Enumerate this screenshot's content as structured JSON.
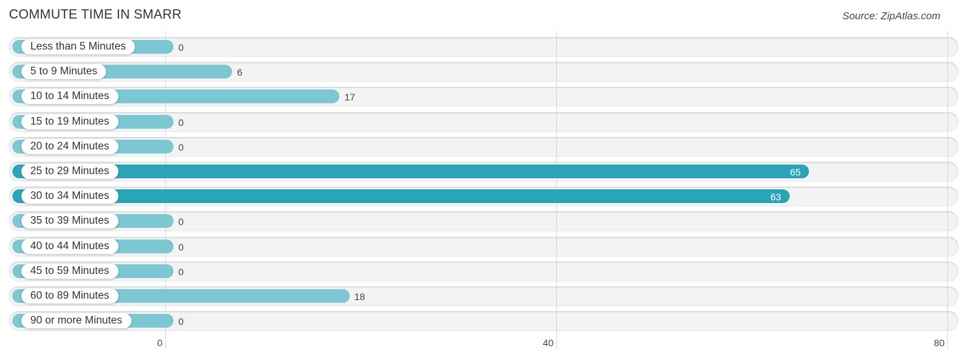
{
  "title": "COMMUTE TIME IN SMARR",
  "source": "Source: ZipAtlas.com",
  "chart_data": {
    "type": "bar",
    "orientation": "horizontal",
    "title": "COMMUTE TIME IN SMARR",
    "categories": [
      "Less than 5 Minutes",
      "5 to 9 Minutes",
      "10 to 14 Minutes",
      "15 to 19 Minutes",
      "20 to 24 Minutes",
      "25 to 29 Minutes",
      "30 to 34 Minutes",
      "35 to 39 Minutes",
      "40 to 44 Minutes",
      "45 to 59 Minutes",
      "60 to 89 Minutes",
      "90 or more Minutes"
    ],
    "values": [
      0,
      6,
      17,
      0,
      0,
      65,
      63,
      0,
      0,
      0,
      18,
      0
    ],
    "xlim": [
      0,
      80
    ],
    "xticks": [
      0,
      40,
      80
    ],
    "xtick_labels": [
      "0",
      "40",
      "80"
    ],
    "grid": true,
    "colors": {
      "normal": "#7cc7d2",
      "highlight": "#2aa4b7"
    },
    "highlight_threshold": 50
  }
}
